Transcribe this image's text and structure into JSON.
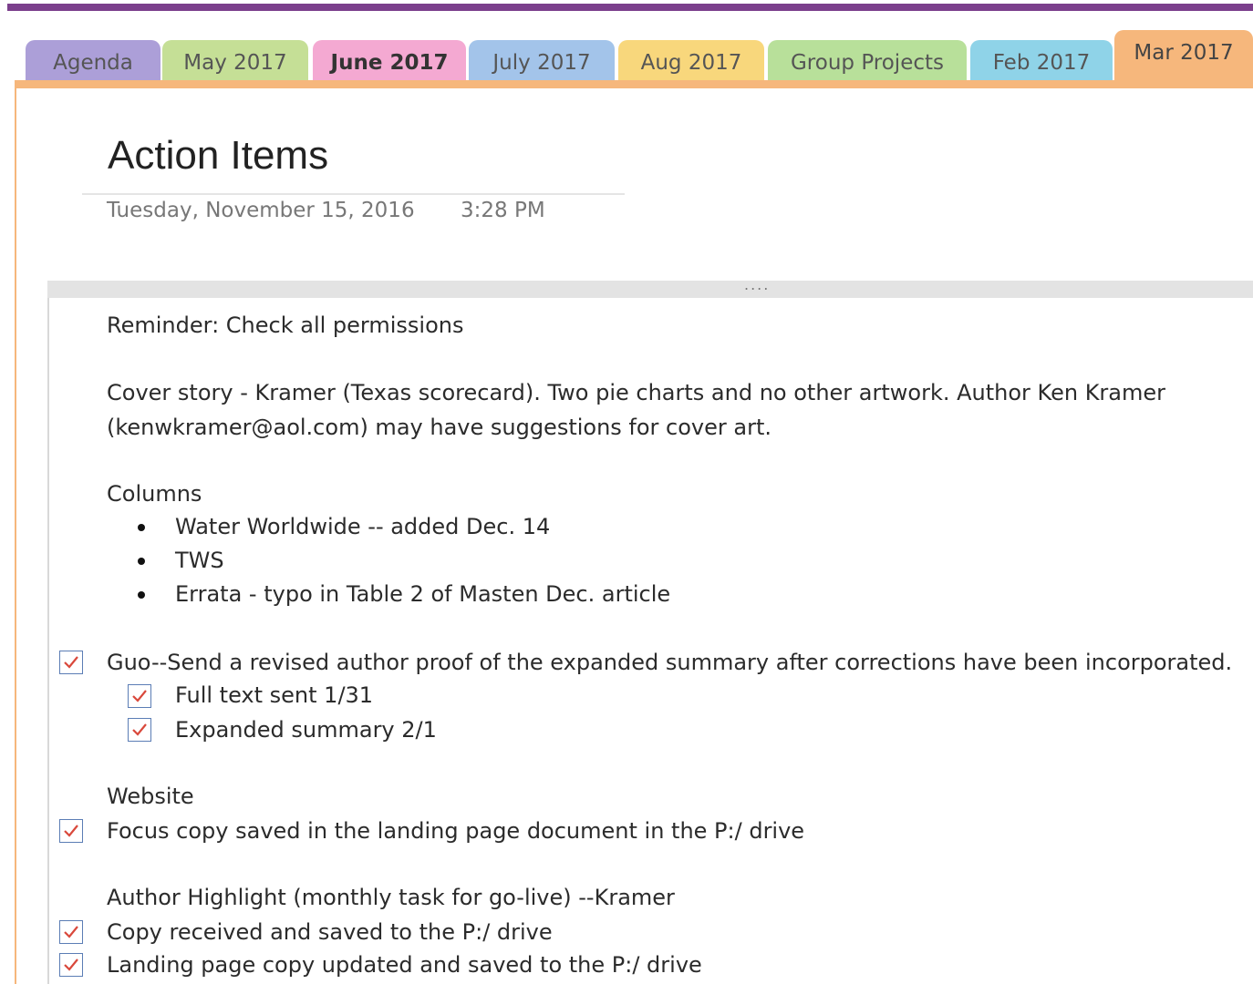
{
  "tabs": [
    {
      "label": "Agenda",
      "color": "#ac9fd8"
    },
    {
      "label": "May 2017",
      "color": "#c5df96"
    },
    {
      "label": "June 2017",
      "color": "#f4a9d2"
    },
    {
      "label": "July 2017",
      "color": "#a3c4ea"
    },
    {
      "label": "Aug 2017",
      "color": "#f8d77c"
    },
    {
      "label": "Group Projects",
      "color": "#b8e09a"
    },
    {
      "label": "Feb 2017",
      "color": "#8fd3e8"
    },
    {
      "label": "Mar 2017",
      "color": "#f6b77c"
    }
  ],
  "page": {
    "title": "Action Items",
    "date": "Tuesday, November 15, 2016",
    "time": "3:28 PM",
    "handle": "...."
  },
  "notes": {
    "reminder": "Reminder: Check all permissions",
    "cover_line1": "Cover story - Kramer (Texas scorecard). Two pie charts and no other artwork. Author Ken Kramer",
    "cover_line2": "(kenwkramer@aol.com) may have suggestions for cover art.",
    "columns_heading": "Columns",
    "columns_items": [
      "Water Worldwide -- added Dec. 14",
      "TWS",
      "Errata - typo in Table 2 of Masten Dec. article"
    ],
    "guo_task": "Guo--Send a revised author proof of the expanded summary after corrections have been incorporated.",
    "guo_subtasks": [
      "Full text sent 1/31",
      "Expanded summary 2/1"
    ],
    "website_heading": "Website",
    "website_task": "Focus copy saved in the landing page document in the P:/ drive",
    "author_heading": "Author Highlight (monthly task for go-live) --Kramer",
    "author_tasks": [
      "Copy received and saved to the P:/ drive",
      "Landing page copy updated and saved to the P:/ drive"
    ]
  },
  "colors": {
    "accent_purple": "#7b3f8c",
    "section_orange": "#f6b77c",
    "check_red": "#d9483b",
    "checkbox_border": "#5b7db5"
  }
}
